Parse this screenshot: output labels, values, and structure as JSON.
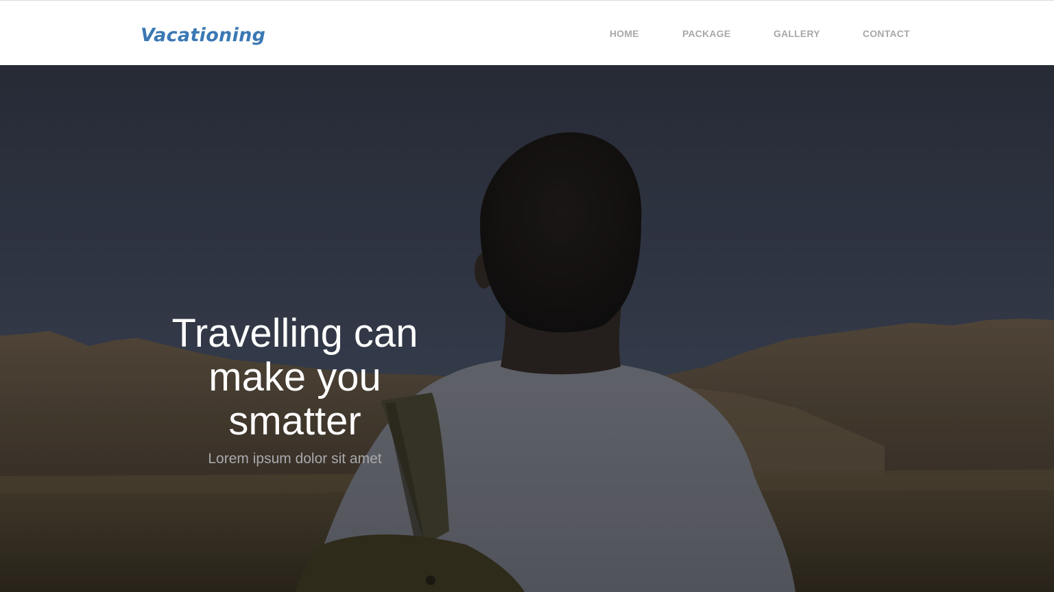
{
  "brand": {
    "logo_text": "Vacationing",
    "accent_color": "#3a78b4"
  },
  "nav": {
    "items": [
      {
        "label": "HOME"
      },
      {
        "label": "PACKAGE"
      },
      {
        "label": "GALLERY"
      },
      {
        "label": "CONTACT"
      }
    ],
    "link_color": "#a8a8a8"
  },
  "hero": {
    "title_line1": "Travelling can",
    "title_line2": "make you",
    "title_line3": "smatter",
    "subtitle": "Lorem ipsum dolor sit amet",
    "background_image": "traveler-with-backpack-facing-desert-mountains"
  }
}
